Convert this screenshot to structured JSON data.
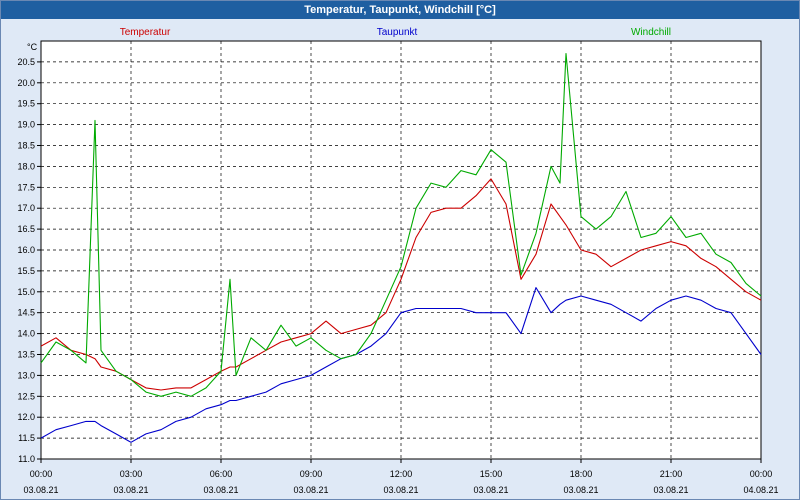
{
  "window": {
    "title": "Temperatur, Taupunkt, Windchill [°C]"
  },
  "legend": {
    "temperatur": "Temperatur",
    "taupunkt": "Taupunkt",
    "windchill": "Windchill"
  },
  "colors": {
    "temperatur": "#cc0000",
    "taupunkt": "#0000cc",
    "windchill": "#00aa00",
    "background": "#dfe9f6",
    "titlebar": "#1f5fa1"
  },
  "chart_data": {
    "type": "line",
    "title": "Temperatur, Taupunkt, Windchill [°C]",
    "ylabel": "°C",
    "ylim": [
      11.0,
      21.0
    ],
    "xlim": [
      0,
      24
    ],
    "grid": true,
    "legend_position": "top",
    "y_ticks": [
      "11.0",
      "11.5",
      "12.0",
      "12.5",
      "13.0",
      "13.5",
      "14.0",
      "14.5",
      "15.0",
      "15.5",
      "16.0",
      "16.5",
      "17.0",
      "17.5",
      "18.0",
      "18.5",
      "19.0",
      "19.5",
      "20.0",
      "20.5"
    ],
    "x_ticks": [
      {
        "time": "00:00",
        "date": "03.08.21"
      },
      {
        "time": "03:00",
        "date": "03.08.21"
      },
      {
        "time": "06:00",
        "date": "03.08.21"
      },
      {
        "time": "09:00",
        "date": "03.08.21"
      },
      {
        "time": "12:00",
        "date": "03.08.21"
      },
      {
        "time": "15:00",
        "date": "03.08.21"
      },
      {
        "time": "18:00",
        "date": "03.08.21"
      },
      {
        "time": "21:00",
        "date": "03.08.21"
      },
      {
        "time": "00:00",
        "date": "04.08.21"
      }
    ],
    "x": [
      0,
      0.5,
      1,
      1.5,
      1.8,
      2,
      2.5,
      3,
      3.5,
      4,
      4.5,
      5,
      5.5,
      6,
      6.3,
      6.5,
      7,
      7.5,
      8,
      8.5,
      9,
      9.5,
      10,
      10.5,
      11,
      11.5,
      12,
      12.5,
      13,
      13.5,
      14,
      14.5,
      15,
      15.5,
      16,
      16.5,
      17,
      17.3,
      17.5,
      18,
      18.5,
      19,
      19.5,
      20,
      20.5,
      21,
      21.5,
      22,
      22.5,
      23,
      23.5,
      24
    ],
    "series": [
      {
        "name": "Temperatur",
        "values": [
          13.7,
          13.9,
          13.6,
          13.5,
          13.4,
          13.2,
          13.1,
          12.9,
          12.7,
          12.65,
          12.7,
          12.7,
          12.9,
          13.1,
          13.2,
          13.2,
          13.4,
          13.6,
          13.8,
          13.9,
          14.0,
          14.3,
          14.0,
          14.1,
          14.2,
          14.5,
          15.3,
          16.3,
          16.9,
          17.0,
          17.0,
          17.3,
          17.7,
          17.1,
          15.3,
          15.9,
          17.1,
          16.8,
          16.6,
          16.0,
          15.9,
          15.6,
          15.8,
          16.0,
          16.1,
          16.2,
          16.1,
          15.8,
          15.6,
          15.3,
          15.0,
          14.8
        ]
      },
      {
        "name": "Taupunkt",
        "values": [
          11.5,
          11.7,
          11.8,
          11.9,
          11.9,
          11.8,
          11.6,
          11.4,
          11.6,
          11.7,
          11.9,
          12.0,
          12.2,
          12.3,
          12.4,
          12.4,
          12.5,
          12.6,
          12.8,
          12.9,
          13.0,
          13.2,
          13.4,
          13.5,
          13.7,
          14.0,
          14.5,
          14.6,
          14.6,
          14.6,
          14.6,
          14.5,
          14.5,
          14.5,
          14.0,
          15.1,
          14.5,
          14.7,
          14.8,
          14.9,
          14.8,
          14.7,
          14.5,
          14.3,
          14.6,
          14.8,
          14.9,
          14.8,
          14.6,
          14.5,
          14.0,
          13.5
        ]
      },
      {
        "name": "Windchill",
        "values": [
          13.3,
          13.8,
          13.6,
          13.3,
          19.1,
          13.6,
          13.1,
          12.9,
          12.6,
          12.5,
          12.6,
          12.5,
          12.7,
          13.1,
          15.3,
          13.0,
          13.9,
          13.6,
          14.2,
          13.7,
          13.9,
          13.6,
          13.4,
          13.5,
          14.0,
          14.8,
          15.6,
          17.0,
          17.6,
          17.5,
          17.9,
          17.8,
          18.4,
          18.1,
          15.4,
          16.4,
          18.0,
          17.6,
          20.7,
          16.8,
          16.5,
          16.8,
          17.4,
          16.3,
          16.4,
          16.8,
          16.3,
          16.4,
          15.9,
          15.7,
          15.2,
          14.9
        ]
      }
    ]
  }
}
